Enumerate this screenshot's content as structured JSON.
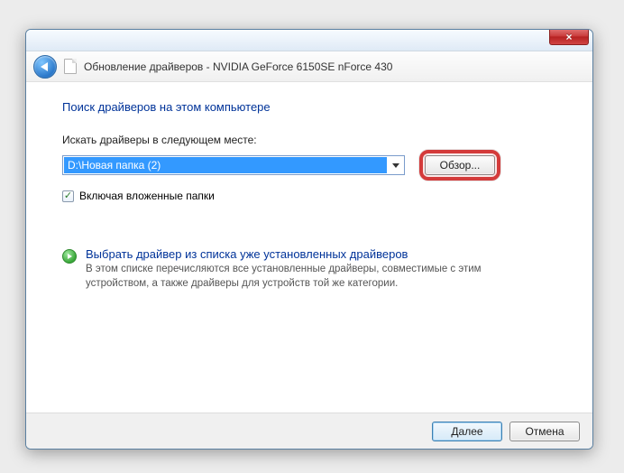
{
  "window": {
    "title": "Обновление драйверов - NVIDIA GeForce 6150SE nForce 430"
  },
  "main": {
    "heading": "Поиск драйверов на этом компьютере",
    "path_label": "Искать драйверы в следующем месте:",
    "path_value": "D:\\Новая папка (2)",
    "browse_label": "Обзор...",
    "checkbox_label": "Включая вложенные папки",
    "checkbox_checked": true,
    "option": {
      "title": "Выбрать драйвер из списка уже установленных драйверов",
      "description": "В этом списке перечисляются все установленные драйверы, совместимые с этим устройством, а также драйверы для устройств той же категории."
    }
  },
  "footer": {
    "next_label": "Далее",
    "cancel_label": "Отмена"
  }
}
